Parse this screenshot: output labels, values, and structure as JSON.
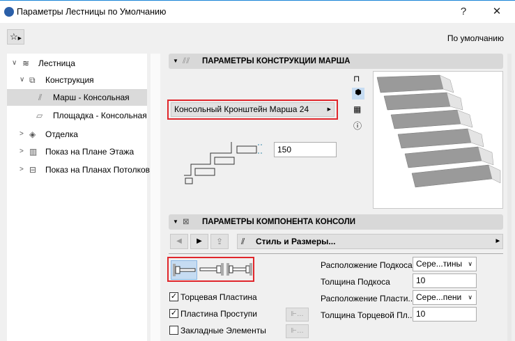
{
  "window": {
    "title": "Параметры Лестницы по Умолчанию",
    "help": "?",
    "close": "✕"
  },
  "toolbar": {
    "preset_label": "По умолчанию"
  },
  "tree": [
    {
      "label": "Лестница"
    },
    {
      "label": "Конструкция"
    },
    {
      "label": "Марш - Консольная"
    },
    {
      "label": "Площадка - Консольная"
    },
    {
      "label": "Отделка"
    },
    {
      "label": "Показ на Плане Этажа"
    },
    {
      "label": "Показ на Планах Потолков"
    }
  ],
  "section1": {
    "title": "ПАРАМЕТРЫ КОНСТРУКЦИИ МАРША",
    "profile": "Консольный Кронштейн Марша 24",
    "offset_value": "150"
  },
  "section2": {
    "title": "ПАРАМЕТРЫ КОМПОНЕНТА КОНСОЛИ",
    "page_label": "Стиль и Размеры...",
    "checkboxes": [
      {
        "label": "Торцевая Пластина",
        "checked": true
      },
      {
        "label": "Пластина Проступи",
        "checked": true
      },
      {
        "label": "Закладные Элементы",
        "checked": false
      }
    ],
    "params": [
      {
        "label": "Расположение Подкоса",
        "value": "Сере...тины",
        "type": "select"
      },
      {
        "label": "Толщина Подкоса",
        "value": "10",
        "type": "input"
      },
      {
        "label": "Расположение Пласти...",
        "value": "Сере...пени",
        "type": "select"
      },
      {
        "label": "Толщина Торцевой Пл...",
        "value": "10",
        "type": "input"
      }
    ]
  }
}
